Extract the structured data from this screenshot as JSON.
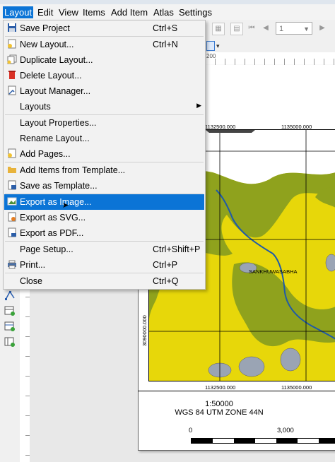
{
  "menubar": {
    "items": [
      "Layout",
      "Edit",
      "View",
      "Items",
      "Add Item",
      "Atlas",
      "Settings"
    ]
  },
  "toolbar": {
    "page_value": "1"
  },
  "ruler": {
    "label": "200"
  },
  "map": {
    "x_coords": [
      "1132500.000",
      "1135000.000"
    ],
    "y_coord": "3090000.000",
    "place_label": "SANKHUWASABHA",
    "colors": {
      "yellow": "#e7d70a",
      "green": "#8fa21d",
      "river": "#1f5aa8",
      "lake": "#9aa4b4"
    }
  },
  "layout_footer": {
    "scale": "1:50000",
    "crs": "WGS 84 UTM ZONE 44N",
    "scale_labels": [
      "0",
      "3,000"
    ]
  },
  "layout_menu": {
    "items": [
      {
        "label": "Save Project",
        "shortcut": "Ctrl+S",
        "icon": "save-icon"
      },
      {
        "label": "New Layout...",
        "shortcut": "Ctrl+N",
        "icon": "new-layout-icon"
      },
      {
        "label": "Duplicate Layout...",
        "shortcut": "",
        "icon": "duplicate-layout-icon"
      },
      {
        "label": "Delete Layout...",
        "shortcut": "",
        "icon": "delete-icon"
      },
      {
        "label": "Layout Manager...",
        "shortcut": "",
        "icon": "layout-manager-icon"
      },
      {
        "label": "Layouts",
        "shortcut": "",
        "icon": ""
      },
      {
        "label": "Layout Properties...",
        "shortcut": "",
        "icon": ""
      },
      {
        "label": "Rename Layout...",
        "shortcut": "",
        "icon": ""
      },
      {
        "label": "Add Pages...",
        "shortcut": "",
        "icon": "add-pages-icon"
      },
      {
        "label": "Add Items from Template...",
        "shortcut": "",
        "icon": "folder-icon"
      },
      {
        "label": "Save as Template...",
        "shortcut": "",
        "icon": "save-template-icon"
      },
      {
        "label": "Export as Image...",
        "shortcut": "",
        "icon": "export-image-icon"
      },
      {
        "label": "Export as SVG...",
        "shortcut": "",
        "icon": "export-svg-icon"
      },
      {
        "label": "Export as PDF...",
        "shortcut": "",
        "icon": "export-pdf-icon"
      },
      {
        "label": "Page Setup...",
        "shortcut": "Ctrl+Shift+P",
        "icon": ""
      },
      {
        "label": "Print...",
        "shortcut": "Ctrl+P",
        "icon": "print-icon"
      },
      {
        "label": "Close",
        "shortcut": "Ctrl+Q",
        "icon": ""
      }
    ]
  }
}
